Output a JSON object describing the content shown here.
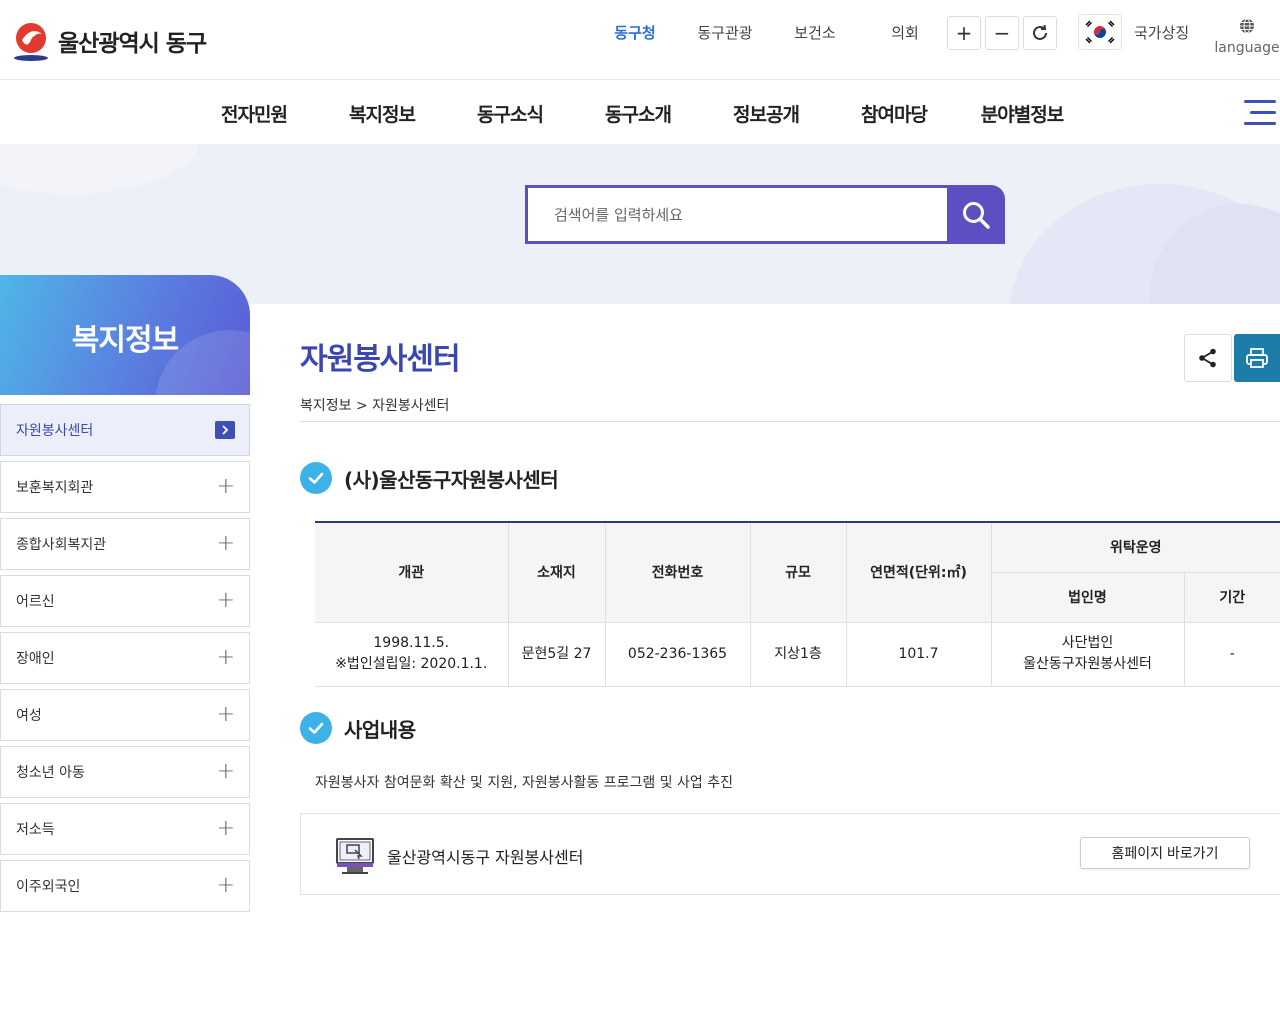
{
  "header": {
    "logo_text": "울산광역시 동구",
    "top_nav": [
      "동구청",
      "동구관광",
      "보건소",
      "의회"
    ],
    "active_top_nav": "동구청",
    "zoom_in": "+",
    "zoom_out": "−",
    "national_symbol_label": "국가상징",
    "language_label": "language"
  },
  "main_nav": {
    "items": [
      "전자민원",
      "복지정보",
      "동구소식",
      "동구소개",
      "정보공개",
      "참여마당",
      "분야별정보"
    ]
  },
  "search": {
    "placeholder": "검색어를 입력하세요"
  },
  "sidebar": {
    "title": "복지정보",
    "items": [
      {
        "label": "자원봉사센터",
        "active": true
      },
      {
        "label": "보훈복지회관",
        "active": false
      },
      {
        "label": "종합사회복지관",
        "active": false
      },
      {
        "label": "어르신",
        "active": false
      },
      {
        "label": "장애인",
        "active": false
      },
      {
        "label": "여성",
        "active": false
      },
      {
        "label": "청소년 아동",
        "active": false
      },
      {
        "label": "저소득",
        "active": false
      },
      {
        "label": "이주외국인",
        "active": false
      }
    ]
  },
  "content": {
    "page_title": "자원봉사센터",
    "breadcrumb": "복지정보 > 자원봉사센터",
    "section1_title": "(사)울산동구자원봉사센터",
    "table": {
      "headers": {
        "opening": "개관",
        "address": "소재지",
        "phone": "전화번호",
        "scale": "규모",
        "area": "연면적(단위:㎡)",
        "consignment": "위탁운영",
        "corp_name": "법인명",
        "period": "기간"
      },
      "row": {
        "opening_line1": "1998.11.5.",
        "opening_line2": "※법인설립일: 2020.1.1.",
        "address": "문현5길 27",
        "phone": "052-236-1365",
        "scale": "지상1층",
        "area": "101.7",
        "corp_line1": "사단법인",
        "corp_line2": "울산동구자원봉사센터",
        "period": "-"
      }
    },
    "section2_title": "사업내용",
    "business_text": "자원봉사자 참여문화 확산 및 지원, 자원봉사활동 프로그램 및 사업 추진",
    "link_name": "울산광역시동구 자원봉사센터",
    "home_button": "홈페이지 바로가기"
  },
  "colors": {
    "brand": "#3b47b0",
    "search_accent": "#5b4fc2",
    "active_top_nav": "#2a6fd6",
    "print_button": "#1d7da8",
    "check_icon": "#3db2e8"
  }
}
